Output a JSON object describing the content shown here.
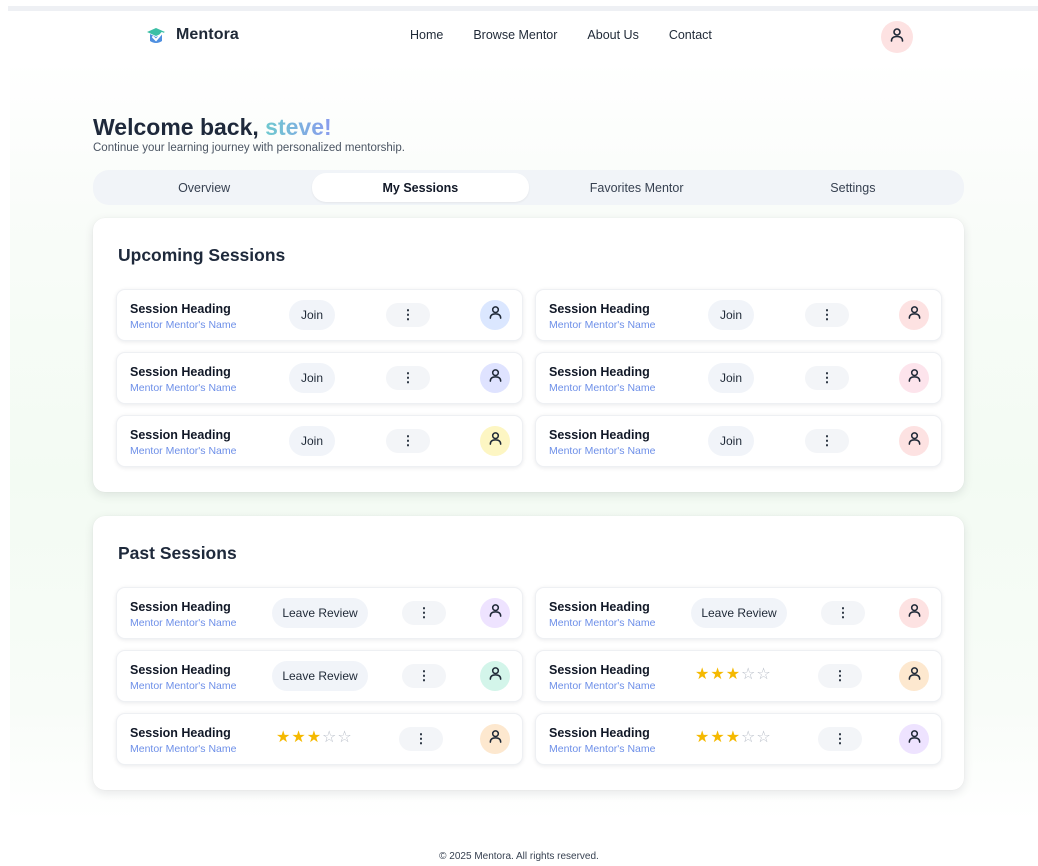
{
  "brand": {
    "name": "Mentora",
    "logo_icon": "graduation-cap-icon"
  },
  "nav": {
    "links": [
      "Home",
      "Browse Mentor",
      "About Us",
      "Contact"
    ],
    "avatar_color": "#fde2e2"
  },
  "welcome": {
    "prefix": "Welcome back, ",
    "username": "steve!",
    "subtitle": "Continue your learning journey with personalized mentorship."
  },
  "tabs": [
    {
      "label": "Overview",
      "active": false
    },
    {
      "label": "My Sessions",
      "active": true
    },
    {
      "label": "Favorites Mentor",
      "active": false
    },
    {
      "label": "Settings",
      "active": false
    }
  ],
  "upcoming": {
    "title": "Upcoming Sessions",
    "sessions": [
      {
        "heading": "Session Heading",
        "mentor": "Mentor Mentor's Name",
        "action": "Join",
        "more": "⋮",
        "avatar_color": "#dbe7ff"
      },
      {
        "heading": "Session Heading",
        "mentor": "Mentor Mentor's Name",
        "action": "Join",
        "more": "⋮",
        "avatar_color": "#fde2e2"
      },
      {
        "heading": "Session Heading",
        "mentor": "Mentor Mentor's Name",
        "action": "Join",
        "more": "⋮",
        "avatar_color": "#dfe3ff"
      },
      {
        "heading": "Session Heading",
        "mentor": "Mentor Mentor's Name",
        "action": "Join",
        "more": "⋮",
        "avatar_color": "#fde4ec"
      },
      {
        "heading": "Session Heading",
        "mentor": "Mentor Mentor's Name",
        "action": "Join",
        "more": "⋮",
        "avatar_color": "#fdf6c3"
      },
      {
        "heading": "Session Heading",
        "mentor": "Mentor Mentor's Name",
        "action": "Join",
        "more": "⋮",
        "avatar_color": "#fde2e2"
      }
    ]
  },
  "past": {
    "title": "Past Sessions",
    "sessions": [
      {
        "heading": "Session Heading",
        "mentor": "Mentor Mentor's Name",
        "action": "Leave Review",
        "rating": null,
        "more": "⋮",
        "avatar_color": "#eee3ff"
      },
      {
        "heading": "Session Heading",
        "mentor": "Mentor Mentor's Name",
        "action": "Leave Review",
        "rating": null,
        "more": "⋮",
        "avatar_color": "#fde2e2"
      },
      {
        "heading": "Session Heading",
        "mentor": "Mentor Mentor's Name",
        "action": "Leave Review",
        "rating": null,
        "more": "⋮",
        "avatar_color": "#d3f5ea"
      },
      {
        "heading": "Session Heading",
        "mentor": "Mentor Mentor's Name",
        "action": null,
        "rating": 3,
        "more": "⋮",
        "avatar_color": "#fde8cf"
      },
      {
        "heading": "Session Heading",
        "mentor": "Mentor Mentor's Name",
        "action": null,
        "rating": 3,
        "more": "⋮",
        "avatar_color": "#fde8cf"
      },
      {
        "heading": "Session Heading",
        "mentor": "Mentor Mentor's Name",
        "action": null,
        "rating": 3,
        "more": "⋮",
        "avatar_color": "#eee3ff"
      }
    ]
  },
  "rating_max": 5,
  "footer": {
    "text": "© 2025 Mentora. All rights reserved."
  },
  "colors": {
    "accent_blue": "#6d8fe8",
    "star": "#f5b900",
    "tab_bg": "#f1f4f8"
  }
}
